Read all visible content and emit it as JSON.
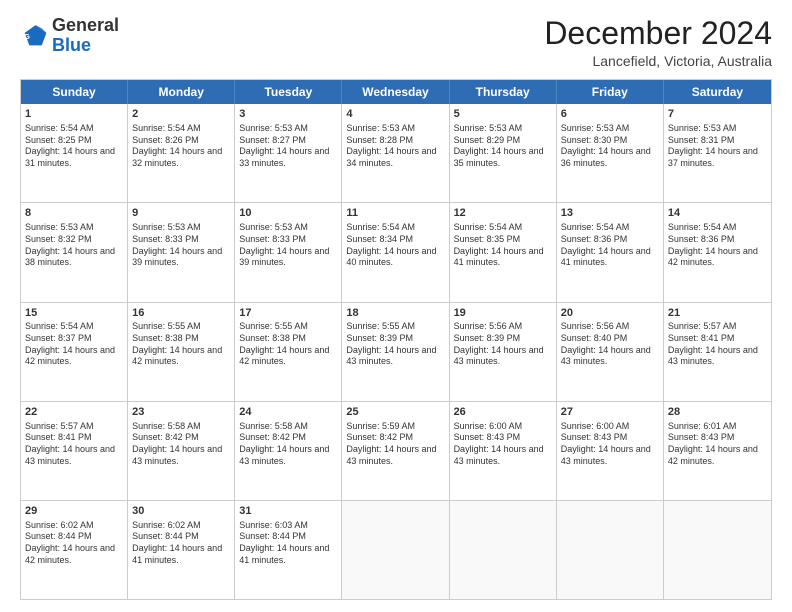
{
  "header": {
    "logo_general": "General",
    "logo_blue": "Blue",
    "month_title": "December 2024",
    "location": "Lancefield, Victoria, Australia"
  },
  "days_of_week": [
    "Sunday",
    "Monday",
    "Tuesday",
    "Wednesday",
    "Thursday",
    "Friday",
    "Saturday"
  ],
  "weeks": [
    [
      {
        "day": 1,
        "sunrise": "5:54 AM",
        "sunset": "8:25 PM",
        "daylight": "14 hours and 31 minutes."
      },
      {
        "day": 2,
        "sunrise": "5:54 AM",
        "sunset": "8:26 PM",
        "daylight": "14 hours and 32 minutes."
      },
      {
        "day": 3,
        "sunrise": "5:53 AM",
        "sunset": "8:27 PM",
        "daylight": "14 hours and 33 minutes."
      },
      {
        "day": 4,
        "sunrise": "5:53 AM",
        "sunset": "8:28 PM",
        "daylight": "14 hours and 34 minutes."
      },
      {
        "day": 5,
        "sunrise": "5:53 AM",
        "sunset": "8:29 PM",
        "daylight": "14 hours and 35 minutes."
      },
      {
        "day": 6,
        "sunrise": "5:53 AM",
        "sunset": "8:30 PM",
        "daylight": "14 hours and 36 minutes."
      },
      {
        "day": 7,
        "sunrise": "5:53 AM",
        "sunset": "8:31 PM",
        "daylight": "14 hours and 37 minutes."
      }
    ],
    [
      {
        "day": 8,
        "sunrise": "5:53 AM",
        "sunset": "8:32 PM",
        "daylight": "14 hours and 38 minutes."
      },
      {
        "day": 9,
        "sunrise": "5:53 AM",
        "sunset": "8:33 PM",
        "daylight": "14 hours and 39 minutes."
      },
      {
        "day": 10,
        "sunrise": "5:53 AM",
        "sunset": "8:33 PM",
        "daylight": "14 hours and 39 minutes."
      },
      {
        "day": 11,
        "sunrise": "5:54 AM",
        "sunset": "8:34 PM",
        "daylight": "14 hours and 40 minutes."
      },
      {
        "day": 12,
        "sunrise": "5:54 AM",
        "sunset": "8:35 PM",
        "daylight": "14 hours and 41 minutes."
      },
      {
        "day": 13,
        "sunrise": "5:54 AM",
        "sunset": "8:36 PM",
        "daylight": "14 hours and 41 minutes."
      },
      {
        "day": 14,
        "sunrise": "5:54 AM",
        "sunset": "8:36 PM",
        "daylight": "14 hours and 42 minutes."
      }
    ],
    [
      {
        "day": 15,
        "sunrise": "5:54 AM",
        "sunset": "8:37 PM",
        "daylight": "14 hours and 42 minutes."
      },
      {
        "day": 16,
        "sunrise": "5:55 AM",
        "sunset": "8:38 PM",
        "daylight": "14 hours and 42 minutes."
      },
      {
        "day": 17,
        "sunrise": "5:55 AM",
        "sunset": "8:38 PM",
        "daylight": "14 hours and 42 minutes."
      },
      {
        "day": 18,
        "sunrise": "5:55 AM",
        "sunset": "8:39 PM",
        "daylight": "14 hours and 43 minutes."
      },
      {
        "day": 19,
        "sunrise": "5:56 AM",
        "sunset": "8:39 PM",
        "daylight": "14 hours and 43 minutes."
      },
      {
        "day": 20,
        "sunrise": "5:56 AM",
        "sunset": "8:40 PM",
        "daylight": "14 hours and 43 minutes."
      },
      {
        "day": 21,
        "sunrise": "5:57 AM",
        "sunset": "8:41 PM",
        "daylight": "14 hours and 43 minutes."
      }
    ],
    [
      {
        "day": 22,
        "sunrise": "5:57 AM",
        "sunset": "8:41 PM",
        "daylight": "14 hours and 43 minutes."
      },
      {
        "day": 23,
        "sunrise": "5:58 AM",
        "sunset": "8:42 PM",
        "daylight": "14 hours and 43 minutes."
      },
      {
        "day": 24,
        "sunrise": "5:58 AM",
        "sunset": "8:42 PM",
        "daylight": "14 hours and 43 minutes."
      },
      {
        "day": 25,
        "sunrise": "5:59 AM",
        "sunset": "8:42 PM",
        "daylight": "14 hours and 43 minutes."
      },
      {
        "day": 26,
        "sunrise": "6:00 AM",
        "sunset": "8:43 PM",
        "daylight": "14 hours and 43 minutes."
      },
      {
        "day": 27,
        "sunrise": "6:00 AM",
        "sunset": "8:43 PM",
        "daylight": "14 hours and 43 minutes."
      },
      {
        "day": 28,
        "sunrise": "6:01 AM",
        "sunset": "8:43 PM",
        "daylight": "14 hours and 42 minutes."
      }
    ],
    [
      {
        "day": 29,
        "sunrise": "6:02 AM",
        "sunset": "8:44 PM",
        "daylight": "14 hours and 42 minutes."
      },
      {
        "day": 30,
        "sunrise": "6:02 AM",
        "sunset": "8:44 PM",
        "daylight": "14 hours and 41 minutes."
      },
      {
        "day": 31,
        "sunrise": "6:03 AM",
        "sunset": "8:44 PM",
        "daylight": "14 hours and 41 minutes."
      },
      null,
      null,
      null,
      null
    ]
  ]
}
